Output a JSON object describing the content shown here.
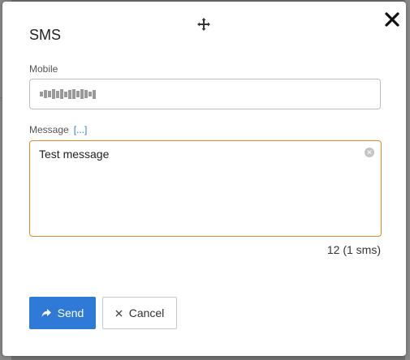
{
  "dialog": {
    "title": "SMS",
    "move_icon": "move-arrows-icon",
    "close_icon": "close-x-icon"
  },
  "mobile": {
    "label": "Mobile",
    "value_masked": true
  },
  "message": {
    "label": "Message",
    "expand_link": "[...]",
    "value": "Test message",
    "clear_icon": "clear-circle-icon",
    "counter": "12 (1 sms)"
  },
  "buttons": {
    "send_label": "Send",
    "send_icon": "share-arrow-icon",
    "cancel_label": "Cancel",
    "cancel_icon": "close-x-icon"
  },
  "colors": {
    "accent": "#2e7ad6",
    "focus_border": "#e08a2c",
    "link": "#2f7bd6"
  }
}
